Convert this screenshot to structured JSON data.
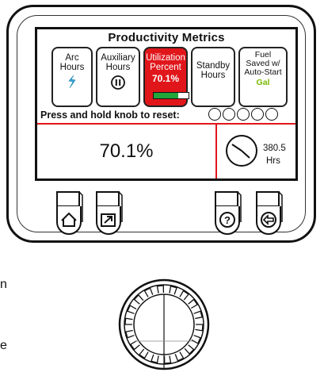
{
  "screen": {
    "title": "Productivity Metrics",
    "tiles": [
      {
        "line1": "Arc",
        "line2": "Hours",
        "icon": "arc-bolt-icon"
      },
      {
        "line1": "Auxiliary",
        "line2": "Hours",
        "icon": "pause-icon"
      },
      {
        "line1": "Utilization",
        "line2": "Percent",
        "value": "70.1%",
        "progress": 0.701,
        "active": true
      },
      {
        "line1": "Standby",
        "line2": "Hours"
      },
      {
        "line1": "Fuel",
        "line2": "Saved w/",
        "line3": "Auto-Start",
        "unit": "Gal"
      }
    ],
    "reset_prompt": "Press and hold knob to reset:",
    "main_value": "70.1%",
    "hours_value": "380.5",
    "hours_unit": "Hrs"
  },
  "buttons": [
    "home-icon",
    "external-link-icon",
    "help-icon",
    "back-arrow-icon"
  ],
  "side_text": [
    "n",
    "e"
  ],
  "colors": {
    "accent_red": "#e0161b",
    "progress_green": "#22a53a",
    "gel_green": "#7ab800"
  }
}
